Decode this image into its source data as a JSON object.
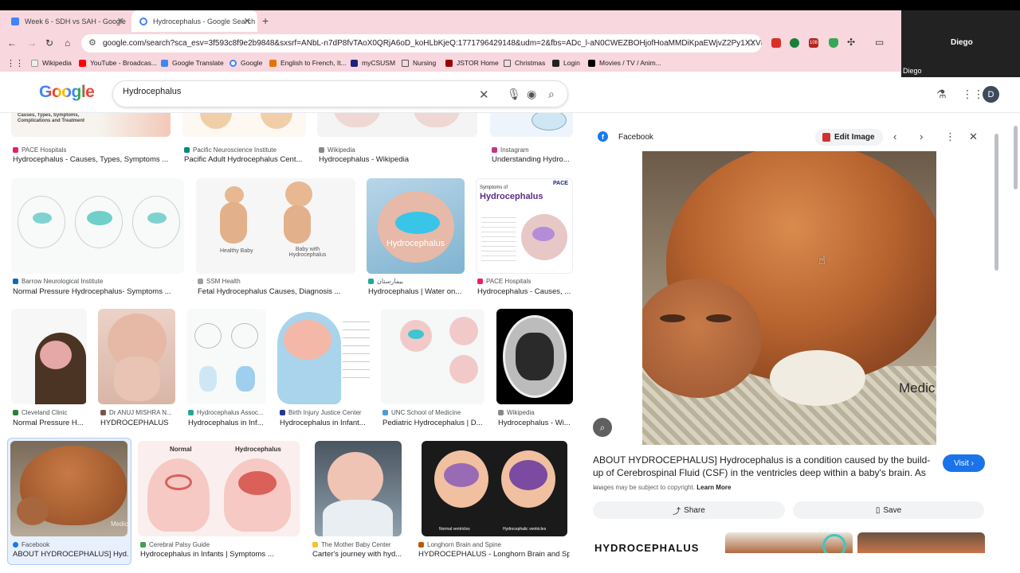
{
  "tabs": [
    {
      "label": "Week 6 - SDH vs SAH - Google",
      "close": "✕"
    },
    {
      "label": "Hydrocephalus - Google Search",
      "close": "✕"
    }
  ],
  "new_tab": "+",
  "video": {
    "name": "Diego",
    "caption": "Diego"
  },
  "url": "google.com/search?sca_esv=3f593c8f9e2b9848&sxsrf=ANbL-n7dP8fvTAoX0QRjA6oD_koHLbKjeQ:1771796429148&udm=2&fbs=ADc_l-aN0CWEZBOHjofHoaMMDiKpaEWjvZ2Py1XXV8d8Kvll3...",
  "bookmarks": [
    {
      "label": "Wikipedia"
    },
    {
      "label": "YouTube - Broadcas..."
    },
    {
      "label": "Google Translate"
    },
    {
      "label": "Google"
    },
    {
      "label": "English to French, It..."
    },
    {
      "label": "myCSUSM"
    },
    {
      "label": "Nursing"
    },
    {
      "label": "JSTOR Home"
    },
    {
      "label": "Christmas"
    },
    {
      "label": "Login"
    },
    {
      "label": "Movies / TV / Anim..."
    }
  ],
  "ext_badge": "108",
  "search": {
    "logo": "Google",
    "query": "Hydrocephalus"
  },
  "avatar": "D",
  "results": [
    {
      "source": "PACE Hospitals",
      "title": "Hydrocephalus - Causes, Types, Symptoms ...",
      "overlay": "Causes, Types, Symptoms, Complications and Treatment"
    },
    {
      "source": "Pacific Neuroscience Institute",
      "title": "Pacific Adult Hydrocephalus Cent..."
    },
    {
      "source": "Wikipedia",
      "title": "Hydrocephalus - Wikipedia"
    },
    {
      "source": "Instagram",
      "title": "Understanding Hydro..."
    },
    {
      "source": "Barrow Neurological Institute",
      "title": "Normal Pressure Hydrocephalus- Symptoms ..."
    },
    {
      "source": "SSM Health",
      "title": "Fetal Hydrocephalus Causes, Diagnosis ...",
      "cap1": "Healthy Baby",
      "cap2": "Baby with Hydrocephalus"
    },
    {
      "source": "بیمارستان",
      "title": "Hydrocephalus | Water on...",
      "overlay": "Hydrocephalus"
    },
    {
      "source": "PACE Hospitals",
      "title": "Hydrocephalus - Causes, ...",
      "overlay1": "Symptoms of",
      "overlay2": "Hydrocephalus",
      "overlay3": "PACE"
    },
    {
      "source": "Cleveland Clinic",
      "title": "Normal Pressure H..."
    },
    {
      "source": "Dr ANUJ MISHRA N...",
      "title": "HYDROCEPHALUS"
    },
    {
      "source": "Hydrocephalus Assoc...",
      "title": "Hydrocephalus in Inf..."
    },
    {
      "source": "Birth Injury Justice Center",
      "title": "Hydrocephalus in Infant..."
    },
    {
      "source": "UNC School of Medicine",
      "title": "Pediatric Hydrocephalus | D..."
    },
    {
      "source": "Wikipedia",
      "title": "Hydrocephalus - Wi..."
    },
    {
      "source": "Facebook",
      "title": "ABOUT HYDROCEPHALUS] Hyd...",
      "watermark": "Medic"
    },
    {
      "source": "Cerebral Palsy Guide",
      "title": "Hydrocephalus in Infants | Symptoms ...",
      "cap1": "Normal",
      "cap2": "Hydrocephalus"
    },
    {
      "source": "The Mother Baby Center",
      "title": "Carter's journey with hyd..."
    },
    {
      "source": "Longhorn Brain and Spine",
      "title": "HYDROCEPHALUS - Longhorn Brain and Spi...",
      "cap1": "Normal ventricles",
      "cap2": "Hydrocephalic ventricles"
    }
  ],
  "panel": {
    "source": "Facebook",
    "edit_label": "Edit Image",
    "watermark": "Medic",
    "description": "ABOUT HYDROCEPHALUS] Hydrocephalus is a condition caused by the build-up of Cerebrospinal Fluid (CSF) in the ventricles deep within a baby's brain. As ...",
    "visit_label": "Visit",
    "copyright": "Images may be subject to copyright.",
    "learn_more": "Learn More",
    "share_label": "Share",
    "save_label": "Save",
    "related_text": "HYDROCEPHALUS"
  },
  "colors": {
    "chrome_pink": "#f8d7df",
    "google_blue": "#1a73e8",
    "brain_teal": "#4fc3c9"
  }
}
